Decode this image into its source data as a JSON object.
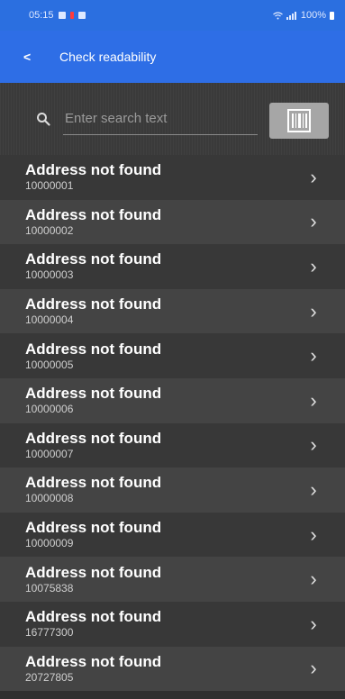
{
  "status_bar": {
    "time": "05:15",
    "battery": "100%"
  },
  "header": {
    "back_icon": "chevron-left-icon",
    "title": "Check readability"
  },
  "search": {
    "placeholder": "Enter search text",
    "value": ""
  },
  "list": {
    "items": [
      {
        "title": "Address not found",
        "code": "10000001"
      },
      {
        "title": "Address not found",
        "code": "10000002"
      },
      {
        "title": "Address not found",
        "code": "10000003"
      },
      {
        "title": "Address not found",
        "code": "10000004"
      },
      {
        "title": "Address not found",
        "code": "10000005"
      },
      {
        "title": "Address not found",
        "code": "10000006"
      },
      {
        "title": "Address not found",
        "code": "10000007"
      },
      {
        "title": "Address not found",
        "code": "10000008"
      },
      {
        "title": "Address not found",
        "code": "10000009"
      },
      {
        "title": "Address not found",
        "code": "10075838"
      },
      {
        "title": "Address not found",
        "code": "16777300"
      },
      {
        "title": "Address not found",
        "code": "20727805"
      }
    ]
  },
  "colors": {
    "accent": "#2e6ee6",
    "row_odd": "#383838",
    "row_even": "#444444"
  }
}
